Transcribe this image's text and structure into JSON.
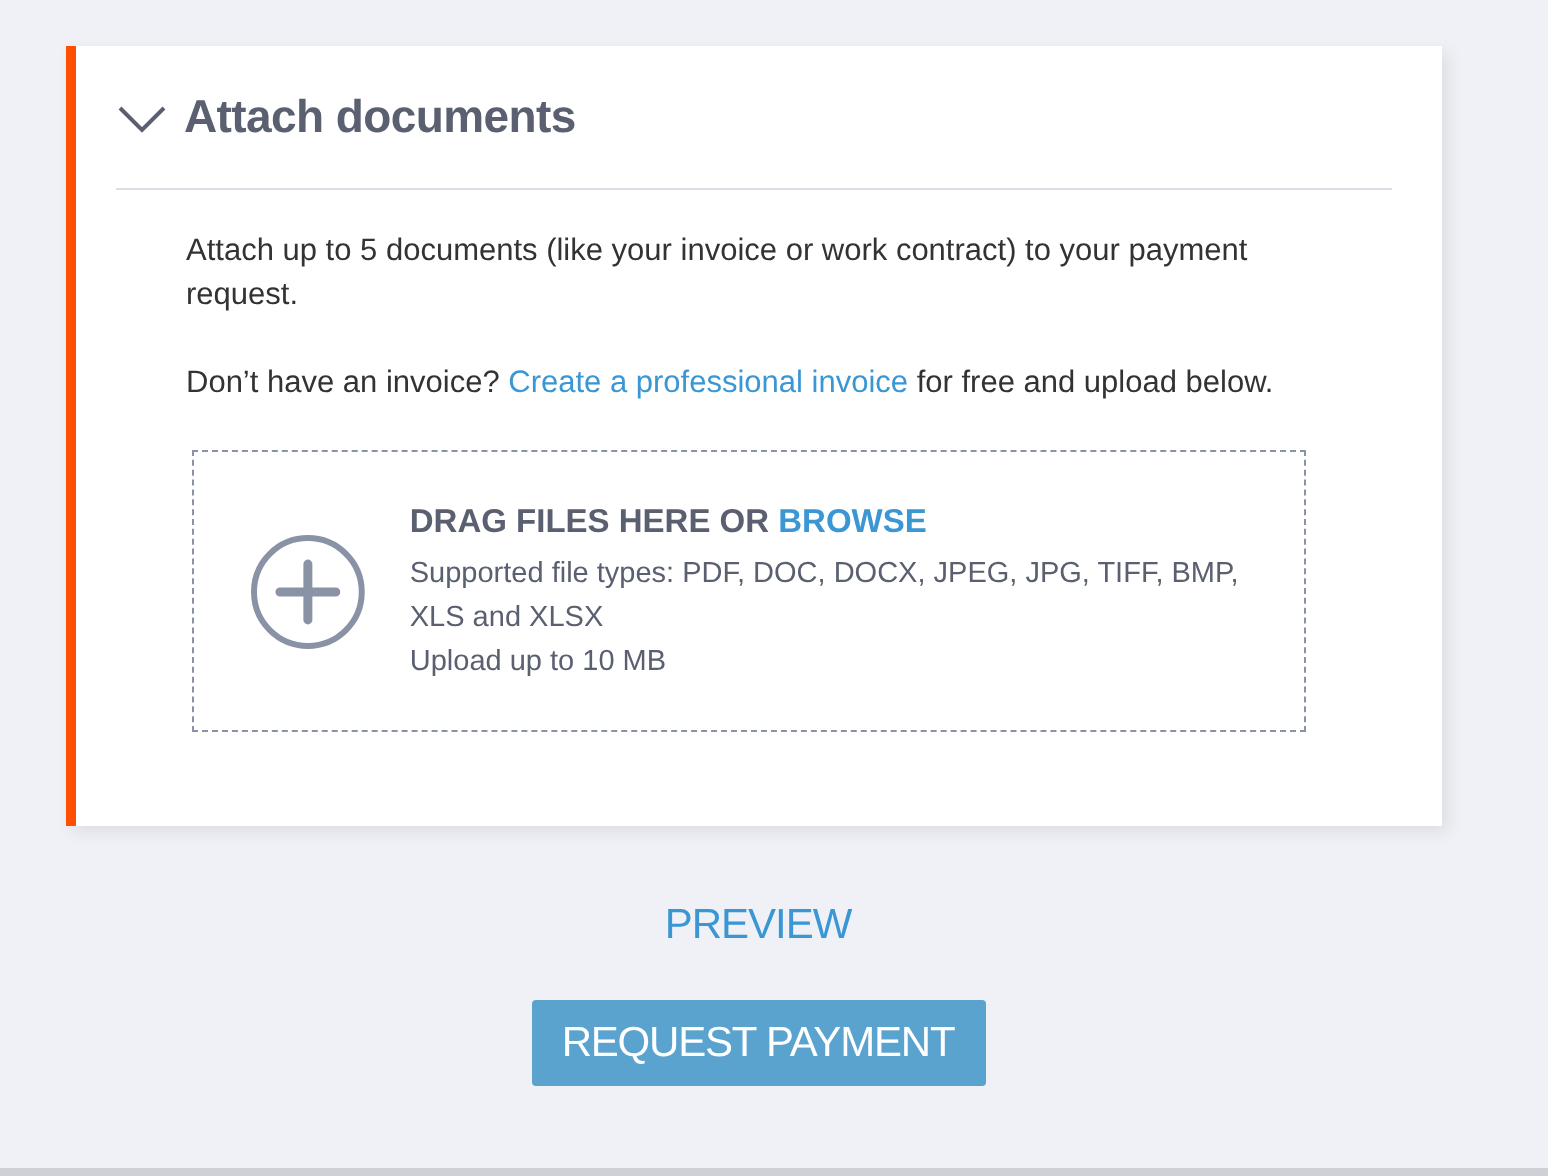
{
  "section": {
    "title": "Attach documents",
    "expanded": true,
    "intro": "Attach up to 5 documents (like your invoice or work contract) to your payment request.",
    "invoice_note": {
      "before": "Don’t have an invoice? ",
      "link": "Create a professional invoice",
      "after": " for free and upload below."
    },
    "dropzone": {
      "heading": "DRAG FILES HERE OR ",
      "browse_link": "BROWSE",
      "file_types": "Supported file types: PDF, DOC, DOCX, JPEG, JPG, TIFF, BMP, XLS and XLSX",
      "size_limit": "Upload up to 10 MB"
    }
  },
  "preview_link": "PREVIEW",
  "submit_button": "REQUEST PAYMENT"
}
